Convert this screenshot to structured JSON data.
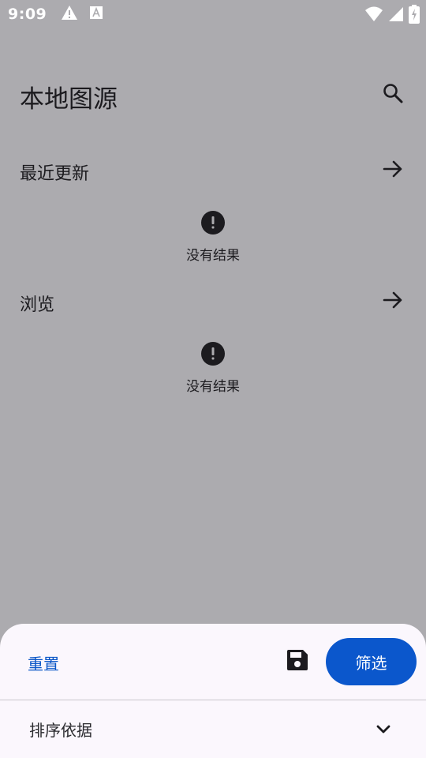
{
  "status_bar": {
    "time": "9:09",
    "icons": [
      "warning-icon",
      "text-a-icon",
      "wifi-icon",
      "signal-icon",
      "battery-charging-icon"
    ]
  },
  "header": {
    "title": "本地图源",
    "search_icon": "search-icon"
  },
  "sections": [
    {
      "title": "最近更新",
      "arrow_icon": "arrow-right-icon",
      "empty_icon": "alert-circle-icon",
      "empty_text": "没有结果"
    },
    {
      "title": "浏览",
      "arrow_icon": "arrow-right-icon",
      "empty_icon": "alert-circle-icon",
      "empty_text": "没有结果"
    }
  ],
  "bottom_sheet": {
    "reset_label": "重置",
    "save_icon": "save-icon",
    "filter_label": "筛选",
    "sort_label": "排序依据",
    "sort_icon": "chevron-down-icon"
  },
  "colors": {
    "scrim_background": "#acabaf",
    "sheet_background": "#fbf7fd",
    "accent": "#0b57cc",
    "text": "#1c1b1f"
  }
}
